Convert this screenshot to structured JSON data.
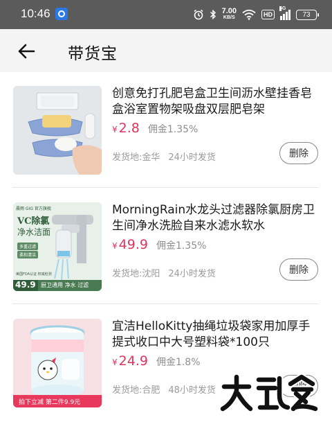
{
  "status_bar": {
    "time": "10:46",
    "net_speed_value": "7.00",
    "net_speed_unit": "KB/S",
    "hd_label": "HD",
    "signal_label": "5G",
    "battery": "73",
    "icons": [
      "app-notification-icon",
      "alarm-icon",
      "bluetooth-icon",
      "wifi-icon",
      "signal-icon",
      "battery-icon"
    ]
  },
  "header": {
    "title": "带货宝"
  },
  "products": [
    {
      "name": "创意免打孔肥皂盒卫生间沥水壁挂香皂盒浴室置物架吸盘双层肥皂架",
      "yen": "¥",
      "price": "2.8",
      "commission": "佣金1.35%",
      "ship_from": "发货地:金华",
      "ship_time": "24小时发货",
      "delete_label": "删除"
    },
    {
      "name": "MorningRain水龙头过滤器除氯厨房卫生间净水洗脸自来水滤水软水",
      "yen": "¥",
      "price": "49.9",
      "commission": "佣金1.35%",
      "ship_from": "发货地:沈阳",
      "ship_time": "24小时发货",
      "delete_label": "删除",
      "thumb_text": {
        "brand": "晨雨 GIG 官方旗舰",
        "headline1": "VC除氯",
        "headline2": "净水洁面",
        "tag1": "多重过滤",
        "tag2": "柔和清洁",
        "badge": "美国FDA认证   权威检测",
        "price": "49.9",
        "footer": "厨卫通用 净水 过滤"
      }
    },
    {
      "name": "宜洁HelloKitty抽绳垃圾袋家用加厚手提式收口中大号塑料袋*100只",
      "yen": "¥",
      "price": "24.9",
      "commission": "佣金1.8%",
      "ship_from": "发货地:合肥",
      "ship_time": "48小时发货",
      "delete_label": "删除",
      "thumb_text": {
        "promo": "拍下立减 第二件9.9元"
      }
    }
  ],
  "watermark": "大玩家",
  "colors": {
    "status_bar_bg": "#5b5b5b",
    "header_bg": "#f4f4f4",
    "price": "#e0335d",
    "secondary_text": "#9a9a9a"
  }
}
